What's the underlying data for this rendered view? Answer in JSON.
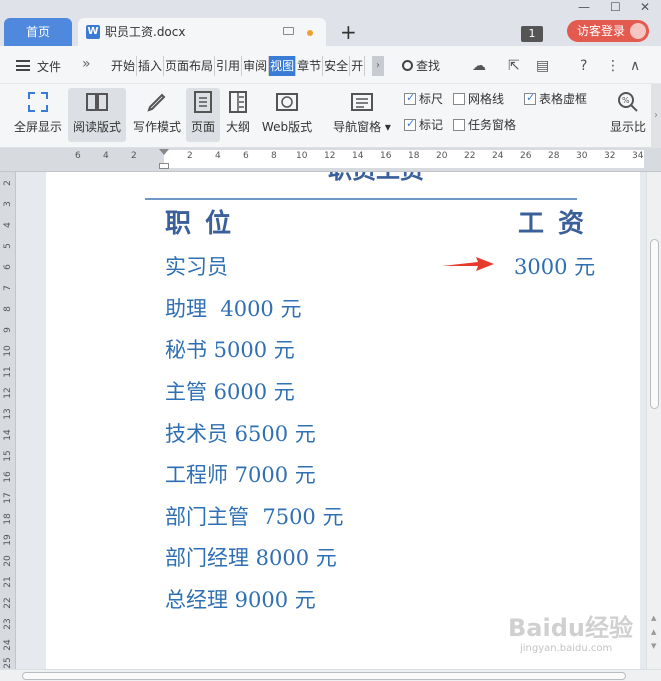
{
  "titlebar": {
    "home_tab": "首页",
    "doc_tab": "职员工资.docx",
    "new_tab": "+",
    "badge": "1",
    "login_button": "访客登录",
    "window_controls": [
      "—",
      "☐",
      "✕"
    ]
  },
  "menubar": {
    "file": "文件",
    "more": "»",
    "tabs": [
      "开始",
      "插入",
      "页面布局",
      "引用",
      "审阅",
      "视图",
      "章节",
      "安全",
      "开"
    ],
    "active_tab": "视图",
    "find": "查找",
    "scroll_right": "›"
  },
  "ribbon": {
    "fullscreen": "全屏显示",
    "read_mode": "阅读版式",
    "write_mode": "写作模式",
    "page": "页面",
    "outline": "大纲",
    "web": "Web版式",
    "nav_pane": "导航窗格",
    "ruler": "标尺",
    "gridlines": "网格线",
    "table_gridlines": "表格虚框",
    "marks": "标记",
    "task_pane": "任务窗格",
    "zoom": "显示比",
    "checks": {
      "ruler": true,
      "gridlines": false,
      "table_gridlines": true,
      "marks": true,
      "task_pane": false
    }
  },
  "ruler": {
    "h_numbers": [
      "6",
      "4",
      "2",
      "2",
      "4",
      "6",
      "8",
      "10",
      "12",
      "14",
      "16",
      "18",
      "20",
      "22",
      "24",
      "26",
      "28",
      "30",
      "32",
      "34"
    ],
    "v_numbers": [
      "2",
      "3",
      "4",
      "5",
      "6",
      "7",
      "8",
      "9",
      "10",
      "11",
      "12",
      "13",
      "14",
      "15",
      "16",
      "17",
      "18",
      "19",
      "20",
      "21",
      "22",
      "23",
      "24",
      "25"
    ]
  },
  "document": {
    "title": "职员工资",
    "header_left": "职位",
    "header_right": "工资",
    "rows": [
      "实习员",
      "助理  4000 元",
      "秘书 5000 元",
      "主管 6000 元",
      "技术员 6500 元",
      "工程师 7000 元",
      "部门主管  7500 元",
      "部门经理 8000 元",
      "总经理 9000 元"
    ],
    "first_row_salary": "3000 元",
    "arrow_color": "#e8392e"
  },
  "watermark": {
    "brand": "Baidu经验",
    "url": "jingyan.baidu.com"
  }
}
